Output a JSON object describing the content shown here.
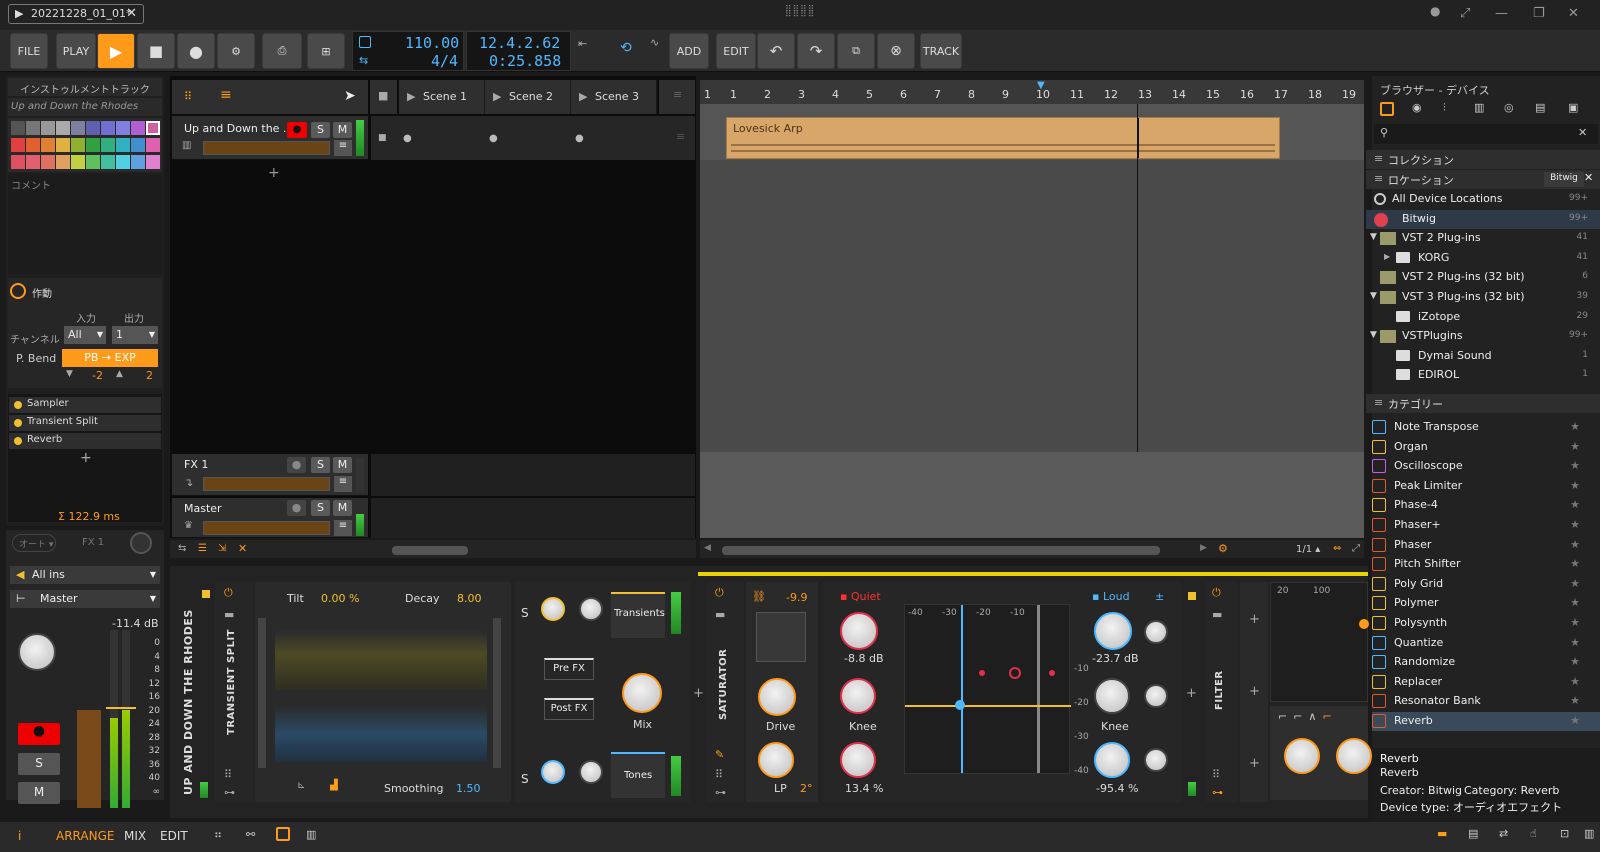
{
  "title_bar": {
    "project_tab": "20221228_01_01*"
  },
  "toolbar": {
    "file": "FILE",
    "play_mode": "PLAY",
    "tempo": "110.00",
    "time_sig": "4/4",
    "position_bars": "12.4.2.62",
    "position_time": "0:25.858",
    "add": "ADD",
    "edit": "EDIT",
    "track": "TRACK"
  },
  "inspector": {
    "header": "インストゥルメントトラック",
    "track_name": "Up and Down the Rhodes",
    "comment_label": "コメント",
    "note_fx_label": "作動",
    "input_label": "入力",
    "output_label": "出力",
    "channel_label": "チャンネル",
    "channel_in": "All",
    "channel_out": "1",
    "pbend_label": "P. Bend",
    "pbend_value": "PB → EXP",
    "pb_down": "-2",
    "pb_up": "2",
    "devices": [
      "Sampler",
      "Transient Split",
      "Reverb"
    ],
    "latency": "Σ 122.9 ms",
    "auto_label": "オート",
    "fx_label": "FX 1",
    "input_select": "All ins",
    "output_select": "Master",
    "level_db": "-11.4 dB",
    "meter_scale": [
      "0",
      "4",
      "8",
      "12",
      "16",
      "20",
      "24",
      "28",
      "32",
      "36",
      "40",
      "∞"
    ],
    "solo": "S",
    "mute": "M"
  },
  "arranger": {
    "scenes": [
      "Scene 1",
      "Scene 2",
      "Scene 3"
    ],
    "tracks": [
      {
        "name": "Up and Down the ...",
        "solo": "S",
        "mute": "M"
      },
      {
        "name": "FX 1",
        "solo": "S",
        "mute": "M"
      },
      {
        "name": "Master",
        "solo": "S",
        "mute": "M"
      }
    ],
    "ruler": [
      "1",
      "1",
      "2",
      "3",
      "4",
      "5",
      "6",
      "7",
      "8",
      "9",
      "10",
      "11",
      "12",
      "13",
      "14",
      "15",
      "16",
      "17",
      "18",
      "19"
    ],
    "clip_name": "Lovesick Arp",
    "zoom": "1/1"
  },
  "browser": {
    "header": "ブラウザー - デバイス",
    "collections": "コレクション",
    "locations": "ロケーション",
    "location_filter": "Bitwig",
    "locations_list": [
      {
        "name": "All Device Locations",
        "count": "99+"
      },
      {
        "name": "Bitwig",
        "count": "99+"
      },
      {
        "name": "VST 2 Plug-ins",
        "count": "41"
      },
      {
        "name": "KORG",
        "count": "41"
      },
      {
        "name": "VST 2 Plug-ins (32 bit)",
        "count": "6"
      },
      {
        "name": "VST 3 Plug-ins (32 bit)",
        "count": "39"
      },
      {
        "name": "iZotope",
        "count": "29"
      },
      {
        "name": "VSTPlugins",
        "count": "99+"
      },
      {
        "name": "Dymai Sound",
        "count": "1"
      },
      {
        "name": "EDIROL",
        "count": "1"
      }
    ],
    "categories": "カテゴリー",
    "devices": [
      "Note Transpose",
      "Organ",
      "Oscilloscope",
      "Peak Limiter",
      "Phase-4",
      "Phaser+",
      "Phaser",
      "Pitch Shifter",
      "Poly Grid",
      "Polymer",
      "Polysynth",
      "Quantize",
      "Randomize",
      "Replacer",
      "Resonator Bank",
      "Reverb"
    ],
    "selected_device": "Reverb",
    "info_title": "Reverb",
    "info_sub": "Reverb",
    "info_creator": "Creator: Bitwig",
    "info_category": "Category: Reverb",
    "info_type": "Device type: オーディオエフェクト"
  },
  "device_panel": {
    "track_label": "UP AND DOWN THE RHODES",
    "transient_split": {
      "label": "TRANSIENT SPLIT",
      "tilt_label": "Tilt",
      "tilt_value": "0.00 %",
      "decay_label": "Decay",
      "decay_value": "8.00",
      "smoothing_label": "Smoothing",
      "smoothing_value": "1.50",
      "s1": "S",
      "s2": "S",
      "transients": "Transients",
      "tones": "Tones",
      "pre_fx": "Pre FX",
      "post_fx": "Post FX",
      "mix": "Mix"
    },
    "saturator": {
      "label": "SATURATOR",
      "gain": "-9.9",
      "drive": "Drive",
      "lp": "LP",
      "lp_val": "2°",
      "quiet": "Quiet",
      "loud": "Loud",
      "quiet_db": "-8.8 dB",
      "loud_db": "-23.7 dB",
      "knee": "Knee",
      "knee2": "Knee",
      "quiet_pct": "13.4 %",
      "loud_pct": "-95.4 %",
      "x_ticks": [
        "-40",
        "-30",
        "-20",
        "-10"
      ],
      "y_ticks": [
        "-10",
        "-20",
        "-30",
        "-40"
      ]
    },
    "filter": {
      "label": "FILTER",
      "f1": "20",
      "f2": "100"
    }
  },
  "bottom_bar": {
    "arrange": "ARRANGE",
    "mix": "MIX",
    "edit": "EDIT"
  },
  "colors": {
    "accent": "#ff9a1a",
    "lcd": "#4fb8ff",
    "clip": "#d9a66a",
    "yellow": "#f0c030"
  }
}
